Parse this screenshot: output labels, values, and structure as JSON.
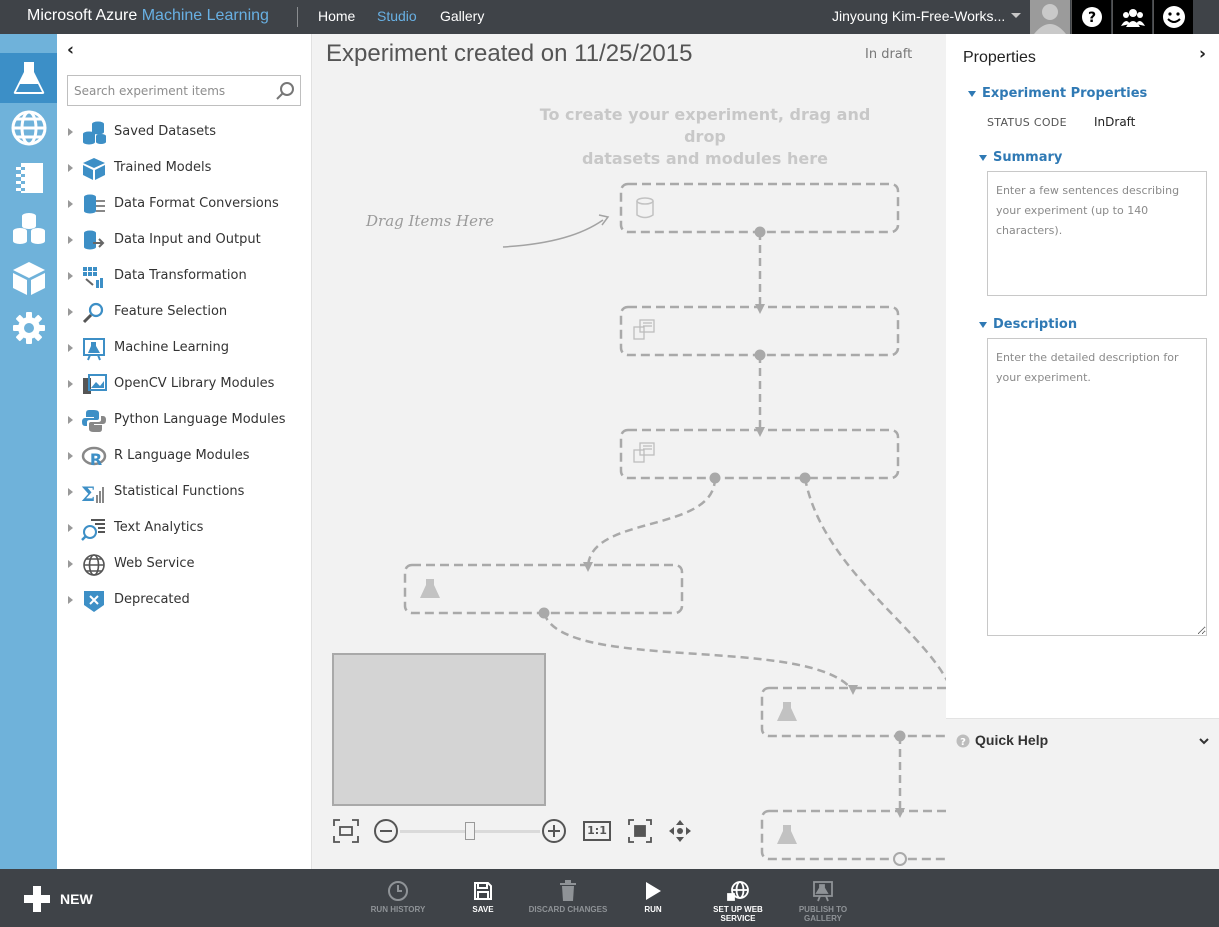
{
  "header": {
    "brand_main": "Microsoft Azure",
    "brand_accent": "Machine Learning",
    "nav": {
      "home": "Home",
      "studio": "Studio",
      "gallery": "Gallery"
    },
    "user_label": "Jinyoung Kim-Free-Works...",
    "icons": [
      "help-icon",
      "community-icon",
      "feedback-smiley-icon"
    ]
  },
  "rail": {
    "items": [
      "experiments-icon",
      "web-services-icon",
      "notebooks-icon",
      "datasets-icon",
      "trained-models-icon",
      "settings-icon"
    ],
    "active": "experiments-icon"
  },
  "palette": {
    "search_placeholder": "Search experiment items",
    "items": [
      {
        "label": "Saved Datasets",
        "icon": "saved-datasets-icon"
      },
      {
        "label": "Trained Models",
        "icon": "trained-models-icon"
      },
      {
        "label": "Data Format Conversions",
        "icon": "data-format-conversions-icon"
      },
      {
        "label": "Data Input and Output",
        "icon": "data-input-output-icon"
      },
      {
        "label": "Data Transformation",
        "icon": "data-transformation-icon"
      },
      {
        "label": "Feature Selection",
        "icon": "feature-selection-icon"
      },
      {
        "label": "Machine Learning",
        "icon": "machine-learning-icon"
      },
      {
        "label": "OpenCV Library Modules",
        "icon": "opencv-icon"
      },
      {
        "label": "Python Language Modules",
        "icon": "python-icon"
      },
      {
        "label": "R Language Modules",
        "icon": "r-language-icon"
      },
      {
        "label": "Statistical Functions",
        "icon": "statistical-functions-icon"
      },
      {
        "label": "Text Analytics",
        "icon": "text-analytics-icon"
      },
      {
        "label": "Web Service",
        "icon": "web-service-icon"
      },
      {
        "label": "Deprecated",
        "icon": "deprecated-icon"
      }
    ]
  },
  "canvas": {
    "title": "Experiment created on 11/25/2015",
    "status": "In draft",
    "hint_line1": "To create your experiment, drag and drop",
    "hint_line2": "datasets and modules here",
    "drag_label": "Drag Items Here",
    "zoom_one_to_one": "1:1",
    "zoom_level": 0.5
  },
  "properties": {
    "title": "Properties",
    "experiment_section": "Experiment Properties",
    "status_code_key": "STATUS CODE",
    "status_code_value": "InDraft",
    "summary_section": "Summary",
    "summary_placeholder": "Enter a few sentences describing your experiment (up to 140 characters).",
    "description_section": "Description",
    "description_placeholder": "Enter the detailed description for your experiment."
  },
  "quick_help": {
    "title": "Quick Help"
  },
  "bottombar": {
    "new_label": "NEW",
    "commands": {
      "run_history": "RUN HISTORY",
      "save": "SAVE",
      "discard": "DISCARD CHANGES",
      "run": "RUN",
      "web_service_l1": "SET UP WEB",
      "web_service_l2": "SERVICE",
      "publish_l1": "PUBLISH TO",
      "publish_l2": "GALLERY"
    }
  },
  "colors": {
    "topbar": "#3f4348",
    "rail": "#6fb2da",
    "rail_active": "#3c8fc7",
    "accent": "#68b0e3",
    "section_blue": "#2f79b4",
    "canvas": "#f2f2f2"
  }
}
